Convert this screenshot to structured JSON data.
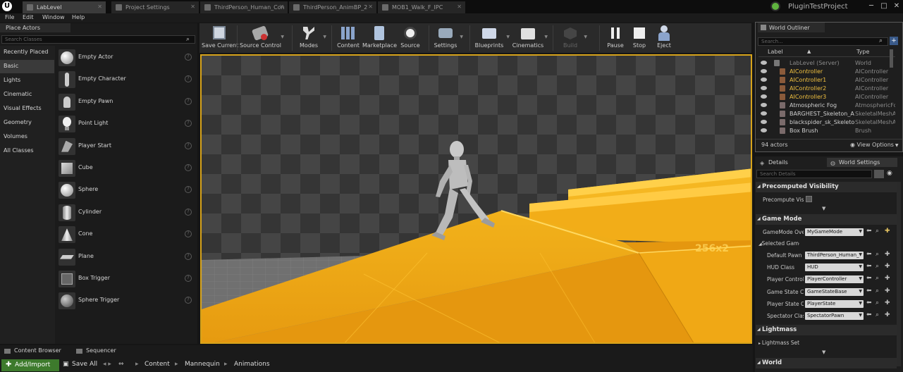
{
  "titlebar": {
    "tabs": [
      {
        "label": "LabLevel",
        "active": true
      },
      {
        "label": "Project Settings",
        "active": false
      },
      {
        "label": "ThirdPerson_Human_Con",
        "active": false
      },
      {
        "label": "ThirdPerson_AnimBP_2",
        "active": false
      },
      {
        "label": "MOB1_Walk_F_IPC",
        "active": false
      }
    ],
    "project_name": "PluginTestProject"
  },
  "menu": {
    "items": [
      "File",
      "Edit",
      "Window",
      "Help"
    ]
  },
  "place_actors": {
    "title": "Place Actors",
    "search_placeholder": "Search Classes",
    "categories": [
      "Recently Placed",
      "Basic",
      "Lights",
      "Cinematic",
      "Visual Effects",
      "Geometry",
      "Volumes",
      "All Classes"
    ],
    "selected_category": "Basic",
    "items": [
      {
        "label": "Empty Actor",
        "icon": "sphere-icon"
      },
      {
        "label": "Empty Character",
        "icon": "character-icon"
      },
      {
        "label": "Empty Pawn",
        "icon": "pawn-icon"
      },
      {
        "label": "Point Light",
        "icon": "lightbulb-icon"
      },
      {
        "label": "Player Start",
        "icon": "player-start-icon"
      },
      {
        "label": "Cube",
        "icon": "cube-icon"
      },
      {
        "label": "Sphere",
        "icon": "sphere-icon"
      },
      {
        "label": "Cylinder",
        "icon": "cylinder-icon"
      },
      {
        "label": "Cone",
        "icon": "cone-icon"
      },
      {
        "label": "Plane",
        "icon": "plane-icon"
      },
      {
        "label": "Box Trigger",
        "icon": "box-trigger-icon"
      },
      {
        "label": "Sphere Trigger",
        "icon": "sphere-trigger-icon"
      }
    ]
  },
  "toolbar": {
    "buttons": [
      {
        "label": "Save Current",
        "icon": "save-icon",
        "dropdown": false,
        "enabled": true
      },
      {
        "label": "Source Control",
        "icon": "source-control-icon",
        "dropdown": true,
        "enabled": true
      },
      {
        "label": "Modes",
        "icon": "modes-icon",
        "dropdown": true,
        "enabled": true
      },
      {
        "label": "Content",
        "icon": "content-icon",
        "dropdown": false,
        "enabled": true
      },
      {
        "label": "Marketplace",
        "icon": "marketplace-icon",
        "dropdown": false,
        "enabled": true
      },
      {
        "label": "Source",
        "icon": "source-icon",
        "dropdown": false,
        "enabled": true
      },
      {
        "label": "Settings",
        "icon": "settings-icon",
        "dropdown": true,
        "enabled": true
      },
      {
        "label": "Blueprints",
        "icon": "blueprints-icon",
        "dropdown": true,
        "enabled": true
      },
      {
        "label": "Cinematics",
        "icon": "cinematics-icon",
        "dropdown": true,
        "enabled": true
      },
      {
        "label": "Build",
        "icon": "build-icon",
        "dropdown": true,
        "enabled": false
      },
      {
        "label": "Pause",
        "icon": "pause-icon",
        "dropdown": false,
        "enabled": true
      },
      {
        "label": "Stop",
        "icon": "stop-icon",
        "dropdown": false,
        "enabled": true
      },
      {
        "label": "Eject",
        "icon": "eject-icon",
        "dropdown": false,
        "enabled": true
      }
    ]
  },
  "viewport": {
    "overlay_text": "256x2"
  },
  "bottom": {
    "tabs": [
      "Content Browser",
      "Sequencer"
    ],
    "add_import": "Add/Import",
    "save_all": "Save All",
    "breadcrumb": [
      "Content",
      "Mannequin",
      "Animations"
    ]
  },
  "world_outliner": {
    "title": "World Outliner",
    "search_placeholder": "Search...",
    "col_label": "Label",
    "col_type": "Type",
    "rows": [
      {
        "label": "LabLevel (Server)",
        "type": "World",
        "highlight": false,
        "dim": true
      },
      {
        "label": "AIController",
        "type": "AIController",
        "highlight": true,
        "dim": false
      },
      {
        "label": "AIController1",
        "type": "AIController",
        "highlight": true,
        "dim": false
      },
      {
        "label": "AIController2",
        "type": "AIController",
        "highlight": true,
        "dim": false
      },
      {
        "label": "AIController3",
        "type": "AIController",
        "highlight": true,
        "dim": false
      },
      {
        "label": "Atmospheric Fog",
        "type": "AtmosphericFo",
        "highlight": false,
        "dim": false
      },
      {
        "label": "BARGHEST_Skeleton_Anim",
        "type": "SkeletalMeshA",
        "highlight": false,
        "dim": false
      },
      {
        "label": "blackspider_sk_Skeleton_A",
        "type": "SkeletalMeshA",
        "highlight": false,
        "dim": false
      },
      {
        "label": "Box Brush",
        "type": "Brush",
        "highlight": false,
        "dim": false
      }
    ],
    "actor_count": "94 actors",
    "view_options": "View Options"
  },
  "details": {
    "tabs": [
      "Details",
      "World Settings"
    ],
    "search_placeholder": "Search Details",
    "sections": {
      "precomputed": "Precomputed Visibility",
      "precompute_label": "Precompute Visit",
      "game_mode": "Game Mode",
      "gamemode_override_label": "GameMode Over",
      "gamemode_override_value": "MyGameMode",
      "selected_gamemode": "Selected GameM",
      "lightmass": "Lightmass",
      "lightmass_settings": "Lightmass Settin",
      "world": "World"
    },
    "fields": [
      {
        "label": "Default Pawn C",
        "value": "ThirdPerson_Human_"
      },
      {
        "label": "HUD Class",
        "value": "HUD"
      },
      {
        "label": "Player Control",
        "value": "PlayerController"
      },
      {
        "label": "Game State Cla",
        "value": "GameStateBase"
      },
      {
        "label": "Player State Cl",
        "value": "PlayerState"
      },
      {
        "label": "Spectator Clas",
        "value": "SpectatorPawn"
      }
    ]
  },
  "colors": {
    "accent_yellow": "#d7a31a",
    "highlight_text": "#f0c040",
    "add_import_green": "#3d7a2c"
  }
}
